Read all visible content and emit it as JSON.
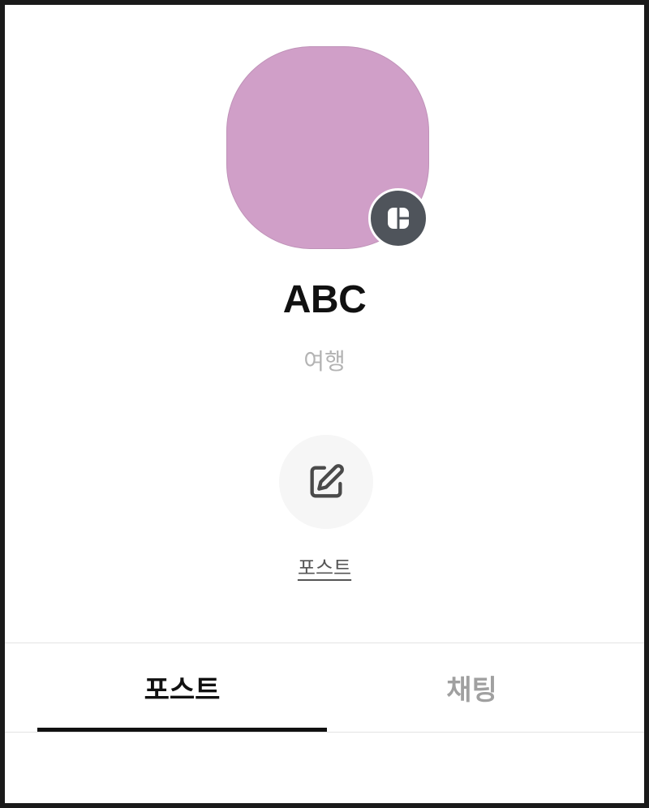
{
  "profile": {
    "name": "ABC",
    "category": "여행",
    "avatar_color": "#d09fc8",
    "badge_icon": "blog-grid-icon"
  },
  "action": {
    "icon": "edit-icon",
    "label": "포스트"
  },
  "tabs": [
    {
      "label": "포스트",
      "selected": true
    },
    {
      "label": "채팅",
      "selected": false
    }
  ]
}
